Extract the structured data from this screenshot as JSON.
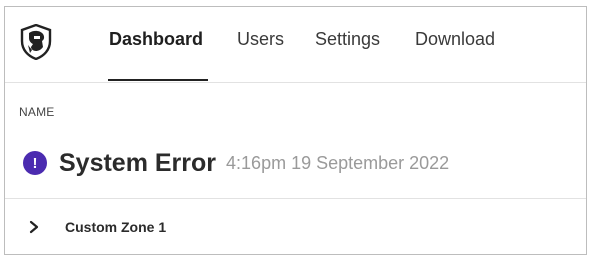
{
  "nav": {
    "logo_icon": "shield-knight-logo-icon",
    "tabs": [
      {
        "label": "Dashboard",
        "active": true
      },
      {
        "label": "Users",
        "active": false
      },
      {
        "label": "Settings",
        "active": false
      },
      {
        "label": "Download",
        "active": false
      }
    ]
  },
  "content": {
    "column_header": "NAME",
    "alert": {
      "icon": "exclamation-icon",
      "icon_glyph": "!",
      "icon_color": "#4b2bb0",
      "title": "System Error",
      "timestamp": "4:16pm 19 September 2022"
    },
    "rows": [
      {
        "icon": "chevron-right-icon",
        "label": "Custom Zone 1"
      }
    ]
  }
}
